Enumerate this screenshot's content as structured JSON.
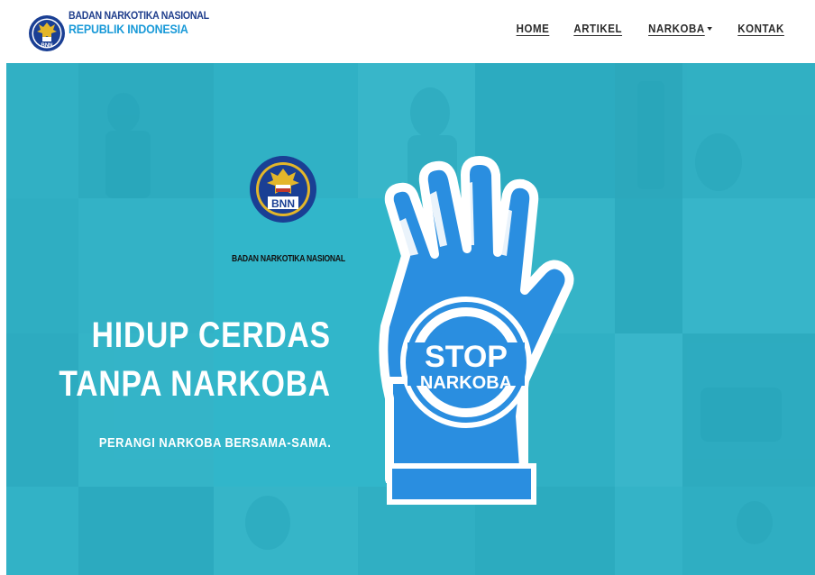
{
  "header": {
    "brand_line1": "BADAN NARKOTIKA NASIONAL",
    "brand_line2": "REPUBLIK INDONESIA",
    "logo_icon": "bnn-emblem-icon"
  },
  "nav": {
    "items": [
      {
        "label": "HOME"
      },
      {
        "label": "ARTIKEL"
      },
      {
        "label": "NARKOBA",
        "has_dropdown": true
      },
      {
        "label": "KONTAK"
      }
    ]
  },
  "hero": {
    "logo_caption": "BADAN NARKOTIKA NASIONAL",
    "logo_text": "BNN",
    "headline_line1": "HIDUP CERDAS",
    "headline_line2": "TANPA NARKOBA",
    "subline": "PERANGI NARKOBA BERSAMA-SAMA.",
    "stop_sign": {
      "line1": "STOP",
      "line2": "NARKOBA"
    }
  },
  "colors": {
    "brand_dark_blue": "#1f3e8c",
    "brand_light_blue": "#1a9ad8",
    "hero_teal": "#38b8cc",
    "hand_blue": "#2a8ee0",
    "nav_text": "#2b2b2b"
  }
}
